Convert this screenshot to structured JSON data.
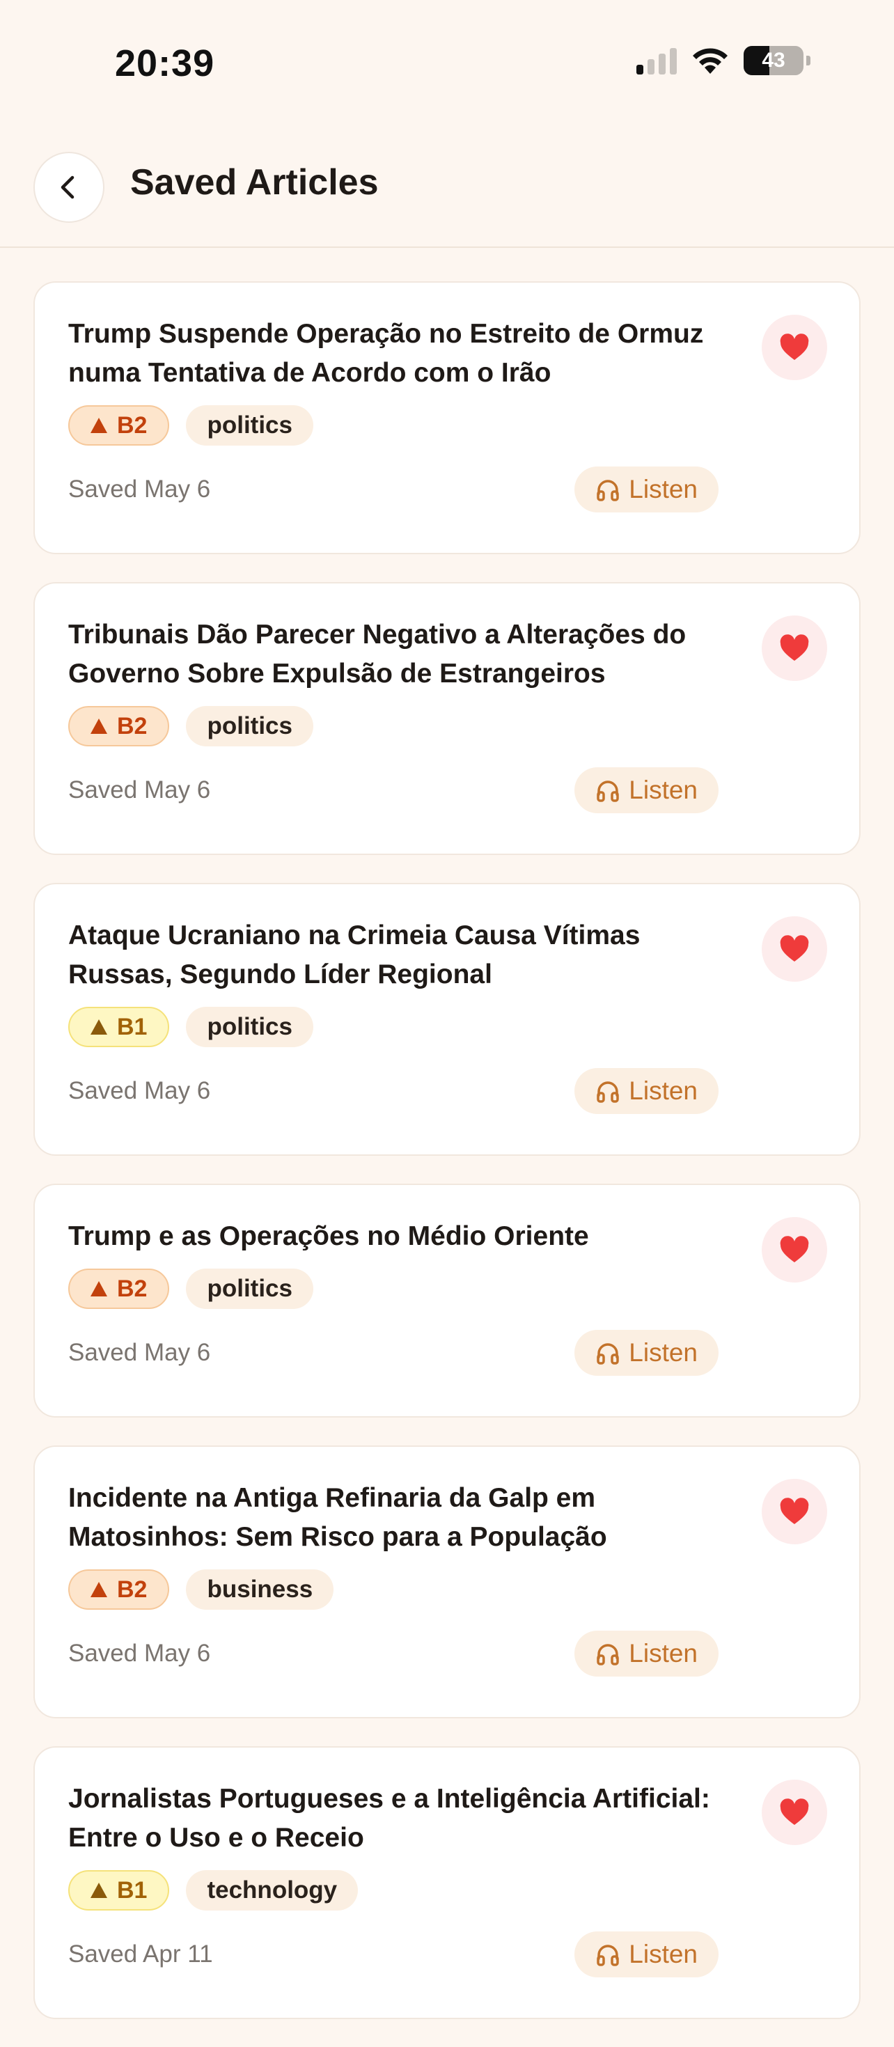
{
  "status_bar": {
    "time": "20:39",
    "battery": "43",
    "battery_level": 0.43
  },
  "header": {
    "title": "Saved Articles",
    "back_icon": "chevron-left-icon"
  },
  "articles": [
    {
      "title": "Trump Suspende Operação no Estreito de Ormuz numa Tentativa de Acordo com o Irão",
      "level": "B2",
      "topic": "politics",
      "saved": "Saved May 6",
      "listen": "Listen"
    },
    {
      "title": "Tribunais Dão Parecer Negativo a Alterações do Governo Sobre Expulsão de Estrangeiros",
      "level": "B2",
      "topic": "politics",
      "saved": "Saved May 6",
      "listen": "Listen"
    },
    {
      "title": "Ataque Ucraniano na Crimeia Causa Vítimas Russas, Segundo Líder Regional",
      "level": "B1",
      "topic": "politics",
      "saved": "Saved May 6",
      "listen": "Listen"
    },
    {
      "title": "Trump e as Operações no Médio Oriente",
      "level": "B2",
      "topic": "politics",
      "saved": "Saved May 6",
      "listen": "Listen"
    },
    {
      "title": "Incidente na Antiga Refinaria da Galp em Matosinhos: Sem Risco para a População",
      "level": "B2",
      "topic": "business",
      "saved": "Saved May 6",
      "listen": "Listen"
    },
    {
      "title": "Jornalistas Portugueses e a Inteligência Artificial: Entre o Uso e o Receio",
      "level": "B1",
      "topic": "technology",
      "saved": "Saved Apr 11",
      "listen": "Listen"
    }
  ],
  "colors": {
    "background": "#fdf6f0",
    "heart": "#ef3b3b",
    "b2": "#c2410c",
    "b1": "#a16207",
    "listen": "#c2722a"
  }
}
